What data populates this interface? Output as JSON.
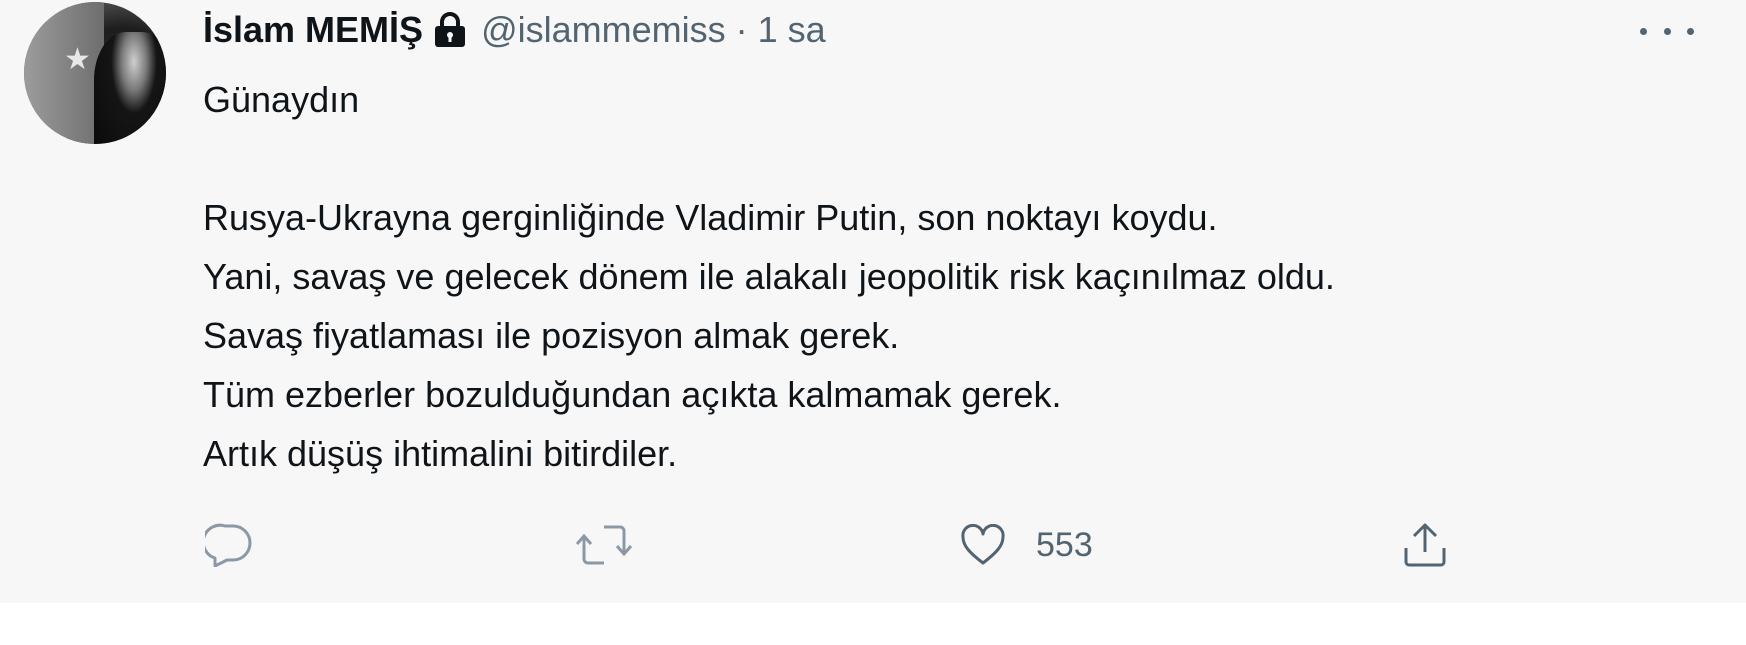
{
  "tweet": {
    "author": {
      "name": "İslam MEMİŞ",
      "handle": "@islammemiss",
      "separator": "·",
      "time": "1 sa",
      "avatar_icon": "profile-photo",
      "protected_icon": "lock-icon"
    },
    "text_lines": [
      "Günaydın",
      "",
      "Rusya-Ukrayna gerginliğinde Vladimir Putin, son noktayı koydu.",
      "Yani, savaş ve gelecek dönem ile alakalı jeopolitik risk kaçınılmaz oldu.",
      "Savaş fiyatlaması ile pozisyon almak gerek.",
      "Tüm ezberler bozulduğundan açıkta kalmamak gerek.",
      "Artık düşüş ihtimalini bitirdiler."
    ],
    "actions": {
      "reply_icon": "reply-icon",
      "retweet_icon": "retweet-icon",
      "like_icon": "heart-icon",
      "like_count": "553",
      "share_icon": "share-icon"
    },
    "more_icon": "more-options-icon"
  },
  "colors": {
    "background": "#f7f7f7",
    "text": "#0f1419",
    "secondary": "#536471"
  }
}
